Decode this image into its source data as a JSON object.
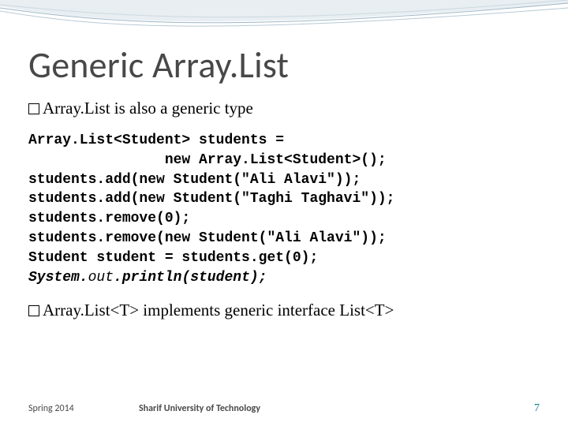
{
  "title": "Generic Array.List",
  "bullets": {
    "b1": "Array.List is also a generic type",
    "b2": "Array.List<T> implements generic interface List<T>"
  },
  "code": {
    "l1": "Array.List<Student> students =",
    "l2": "                new Array.List<Student>();",
    "l3": "students.add(new Student(\"Ali Alavi\"));",
    "l4": "students.add(new Student(\"Taghi Taghavi\"));",
    "l5": "students.remove(0);",
    "l6": "students.remove(new Student(\"Ali Alavi\"));",
    "l7": "Student student = students.get(0);",
    "l8a": "System.",
    "l8b": "out",
    "l8c": ".",
    "l8d": "println(student);"
  },
  "footer": {
    "term": "Spring 2014",
    "institution": "Sharif University of Technology",
    "page": "7"
  },
  "colors": {
    "title": "#484848",
    "accent": "#0a7a8a"
  }
}
